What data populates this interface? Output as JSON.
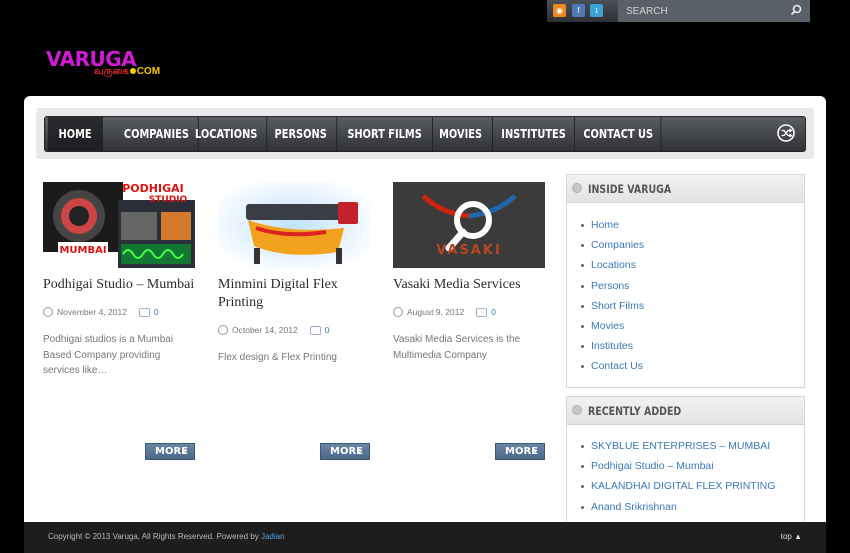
{
  "header": {
    "search_placeholder": "SEARCH",
    "logo_main": "VARUGA",
    "logo_tamil": "வருகை",
    "logo_com": "COM"
  },
  "nav": {
    "items": [
      "HOME",
      "COMPANIES",
      "LOCATIONS",
      "PERSONS",
      "SHORT FILMS",
      "MOVIES",
      "INSTITUTES",
      "CONTACT US"
    ]
  },
  "posts": [
    {
      "image_caption_top": "PODHIGAI",
      "image_caption_sub": "STUDIO",
      "image_caption_bottom": "MUMBAI",
      "title_line1": "Podhigai Studio – Mumbai",
      "title_line2": "",
      "date": "November 4, 2012",
      "comments": "0",
      "excerpt_line1": "Podhigai studios is a Mumbai",
      "excerpt_line2": "Based Company providing",
      "excerpt_line3": "services like…",
      "more": "MORE"
    },
    {
      "title_line1": "Minmini Digital Flex",
      "title_line2": "Printing",
      "date": "October 14, 2012",
      "comments": "0",
      "excerpt_line1": "Flex design & Flex Printing",
      "excerpt_line2": "",
      "excerpt_line3": "",
      "more": "MORE"
    },
    {
      "image_caption": "VASAKI",
      "title_line1": "Vasaki Media Services",
      "title_line2": "",
      "date": "August 9, 2012",
      "comments": "0",
      "excerpt_line1": "Vasaki Media Services is the",
      "excerpt_line2": "Multimedia Company",
      "excerpt_line3": "",
      "more": "MORE"
    }
  ],
  "sidebar": {
    "inside": {
      "title": "INSIDE VARUGA",
      "items": [
        "Home",
        "Companies",
        "Locations",
        "Persons",
        "Short Films",
        "Movies",
        "Institutes",
        "Contact Us"
      ]
    },
    "recent": {
      "title": "RECENTLY ADDED",
      "items": [
        "SKYBLUE ENTERPRISES – MUMBAI",
        "Podhigai Studio – Mumbai",
        "KALANDHAI DIGITAL FLEX PRINTING",
        "Anand Srikrishnan"
      ]
    }
  },
  "footer": {
    "copyright": "Copyright © 2013 Varuga, All Rights Reserved. Powered by ",
    "powered_link": "Jadian",
    "top_label": "top"
  },
  "colors": {
    "accent": "#3a79b7",
    "logo": "#d11ad6",
    "nav_bg": "#3f4246"
  }
}
